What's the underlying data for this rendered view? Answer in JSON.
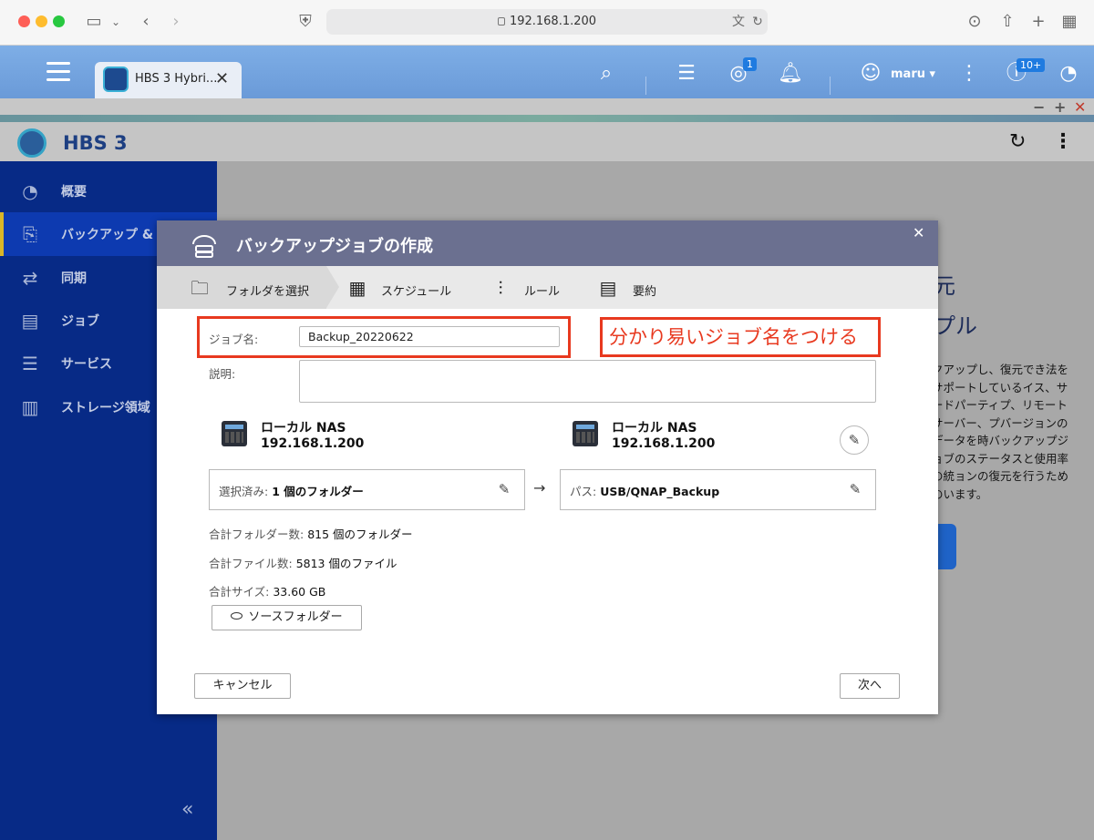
{
  "browser": {
    "url": "192.168.1.200",
    "tab_label": "HBS 3 Hybri..."
  },
  "qts": {
    "user_label": "maru ▾",
    "notif_badge": "1",
    "alert_badge": "10+"
  },
  "app": {
    "title": "HBS 3"
  },
  "sidebar": {
    "items": [
      {
        "label": "概要"
      },
      {
        "label": "バックアップ & 復"
      },
      {
        "label": "同期"
      },
      {
        "label": "ジョブ"
      },
      {
        "label": "サービス"
      },
      {
        "label": "ストレージ領域"
      }
    ]
  },
  "background": {
    "heading1": "元",
    "heading2": "プル",
    "text": "クアップし、復元でき法をサポートしているイス、サードパーティプ、リモートサーバー、プバージョンのデータを時バックアップジョブのステータスと使用率の統ョンの復元を行うためのいます。"
  },
  "dialog": {
    "title": "バックアップジョブの作成",
    "steps": [
      {
        "label": "フォルダを選択"
      },
      {
        "label": "スケジュール"
      },
      {
        "label": "ルール"
      },
      {
        "label": "要約"
      }
    ],
    "job_name_label": "ジョブ名:",
    "job_name_value": "Backup_20220622",
    "description_label": "説明:",
    "description_value": "",
    "annotation": "分かり易いジョブ名をつける",
    "source": {
      "name": "ローカル NAS",
      "ip": "192.168.1.200",
      "path_label": "選択済み:",
      "path_value": "1 個のフォルダー"
    },
    "destination": {
      "name": "ローカル NAS",
      "ip": "192.168.1.200",
      "path_label": "パス:",
      "path_value": "USB/QNAP_Backup"
    },
    "arrow": "→",
    "stats": {
      "folders_label": "合計フォルダー数:",
      "folders_value": "815 個のフォルダー",
      "files_label": "合計ファイル数:",
      "files_value": "5813 個のファイル",
      "size_label": "合計サイズ:",
      "size_value": "33.60 GB"
    },
    "source_folder_button": "ソースフォルダー",
    "cancel_button": "キャンセル",
    "next_button": "次へ"
  }
}
